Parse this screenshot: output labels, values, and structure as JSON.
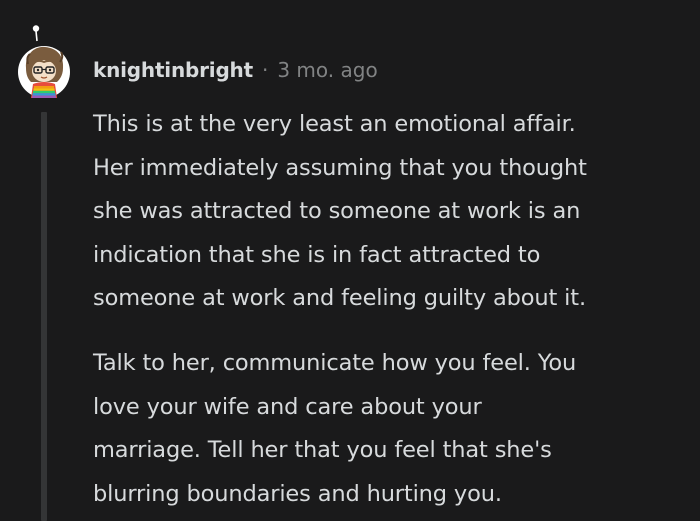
{
  "comment": {
    "username": "knightinbright",
    "separator": "·",
    "timestamp": "3 mo. ago",
    "paragraphs": [
      [
        "This is at the very least an emotional affair.",
        "Her immediately assuming that you thought",
        "she was attracted to someone at work is an",
        "indication that she is in fact attracted to",
        "someone at work and feeling guilty about it."
      ],
      [
        "Talk to her, communicate how you feel. You",
        "love your wife and care about your",
        "marriage. Tell her that you feel that she's",
        "blurring boundaries and hurting you."
      ]
    ]
  },
  "colors": {
    "background": "#1a1a1b",
    "text": "#d7dadc",
    "muted": "#818384",
    "thread_line": "#343536"
  },
  "avatar": {
    "icon": "user-avatar-icon"
  }
}
